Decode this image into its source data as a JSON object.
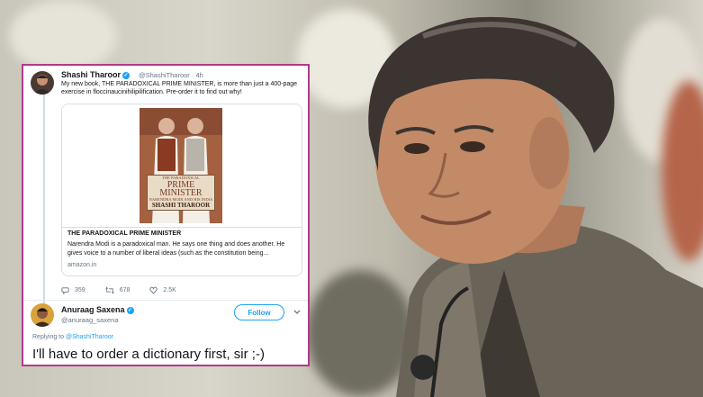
{
  "colors": {
    "accent": "#1da1f2",
    "frame": "#b23a8a",
    "text": "#14171a",
    "muted": "#657786"
  },
  "tweet": {
    "author_name": "Shashi Tharoor",
    "author_handle": "@ShashiTharoor",
    "time": "· 4h",
    "text": "My new book, THE PARADOXICAL PRIME MINISTER, is more than just a 400-page exercise in floccinaucinihilipilification. Pre-order it to find out why!",
    "card": {
      "cover_top": "THE PARADOXICAL",
      "cover_title_line1": "PRIME",
      "cover_title_line2": "MINISTER",
      "cover_subtitle": "NARENDRA MODI AND HIS INDIA",
      "cover_author": "SHASHI THAROOR",
      "title": "THE PARADOXICAL PRIME MINISTER",
      "description": "Narendra Modi is a paradoxical man. He says one thing and does another. He gives voice to a number of liberal ideas (such as the constitution being...",
      "domain": "amazon.in"
    },
    "actions": {
      "replies": "359",
      "retweets": "678",
      "likes": "2.5K"
    }
  },
  "reply": {
    "author_name": "Anuraag Saxena",
    "author_handle": "@anuraag_saxena",
    "follow_label": "Follow",
    "replying_prefix": "Replying to",
    "replying_handle": "@ShashiTharoor",
    "text": "I'll have to order a dictionary first, sir ;-)"
  },
  "icons": [
    "verified-icon",
    "reply-icon",
    "retweet-icon",
    "like-icon",
    "chevron-down-icon"
  ]
}
